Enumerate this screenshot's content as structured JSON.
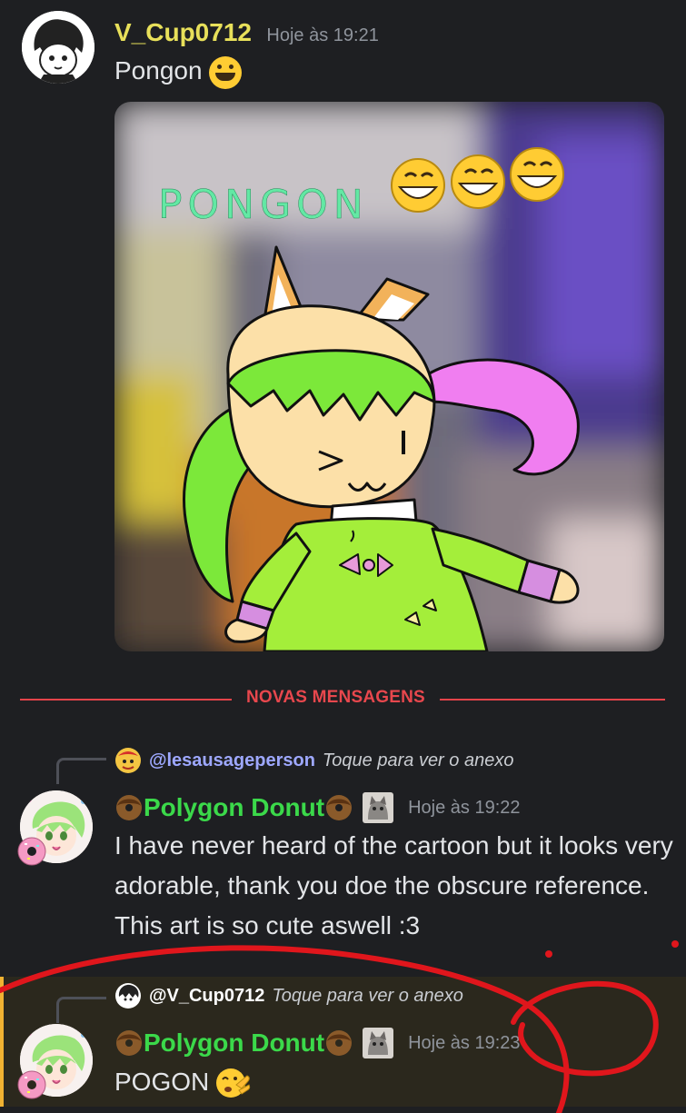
{
  "colors": {
    "background": "#1e1f22",
    "new_messages_red": "#e8474d",
    "username_yellow": "#e8e05a",
    "username_green": "#3bd94a",
    "mention_blue": "#9ea8ff",
    "highlight_bg": "#2b281d",
    "highlight_bar": "#f0b232"
  },
  "messages": [
    {
      "username": "V_Cup0712",
      "timestamp": "Hoje às 19:21",
      "text": "Pongon",
      "text_emoji": "grinning-face-emoji",
      "image": {
        "caption": "PONGON",
        "emoji": "😁😁😁"
      }
    },
    {
      "reply": {
        "mention": "@lesausageperson",
        "hint": "Toque para ver o anexo"
      },
      "username": "Polygon Donut",
      "timestamp": "Hoje às 19:22",
      "text": "I have never heard of the cartoon but it looks very adorable, thank you doe the obscure reference. This art is so cute aswell :3"
    },
    {
      "reply": {
        "mention": "@V_Cup0712",
        "hint": "Toque para ver o anexo"
      },
      "username": "Polygon Donut",
      "timestamp": "Hoje às 19:23",
      "text": "POGON",
      "text_emoji": "clapping-face-emoji"
    }
  ],
  "divider": {
    "label": "NOVAS MENSAGENS"
  }
}
